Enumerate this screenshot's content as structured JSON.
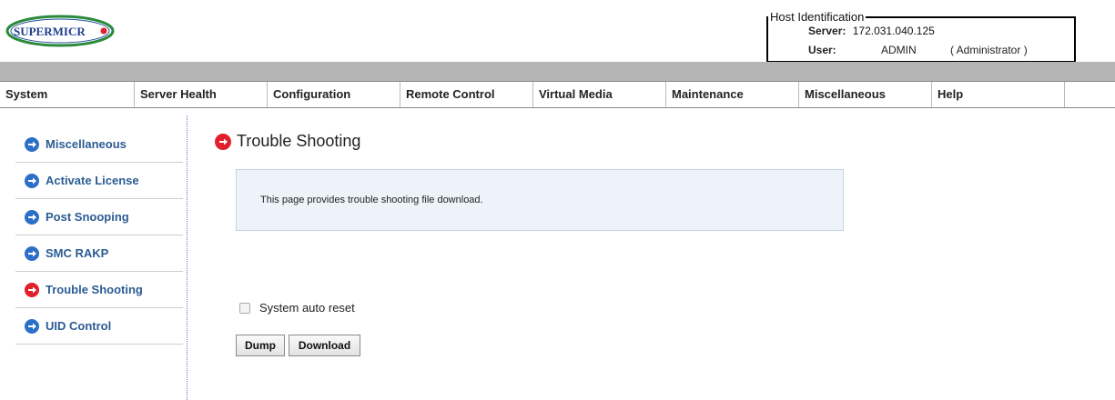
{
  "brand": {
    "logo_text": "SUPERMICR"
  },
  "host": {
    "title": "Host Identification",
    "server_label": "Server:",
    "server_value": "172.031.040.125",
    "user_label": "User:",
    "user_value": "ADMIN",
    "role": "( Administrator )"
  },
  "nav": {
    "items": [
      {
        "label": "System"
      },
      {
        "label": "Server Health"
      },
      {
        "label": "Configuration"
      },
      {
        "label": "Remote Control"
      },
      {
        "label": "Virtual Media"
      },
      {
        "label": "Maintenance"
      },
      {
        "label": "Miscellaneous"
      },
      {
        "label": "Help"
      }
    ]
  },
  "sidebar": {
    "items": [
      {
        "label": "Miscellaneous",
        "icon": "arrow-right-circle-icon",
        "active": false
      },
      {
        "label": "Activate License",
        "icon": "arrow-right-circle-icon",
        "active": false
      },
      {
        "label": "Post Snooping",
        "icon": "arrow-right-circle-icon",
        "active": false
      },
      {
        "label": "SMC RAKP",
        "icon": "arrow-right-circle-icon",
        "active": false
      },
      {
        "label": "Trouble Shooting",
        "icon": "arrow-right-circle-icon",
        "active": true
      },
      {
        "label": "UID Control",
        "icon": "arrow-right-circle-icon",
        "active": false
      }
    ]
  },
  "main": {
    "title": "Trouble Shooting",
    "info": "This page provides trouble shooting file download.",
    "auto_reset_label": "System auto reset",
    "auto_reset_checked": false,
    "dump_label": "Dump",
    "download_label": "Download"
  },
  "colors": {
    "nav_band": "#b4b4b4",
    "link_blue": "#2b5c93",
    "arrow_blue": "#2c6fc7",
    "arrow_red": "#e0202a",
    "info_bg": "#eef3fa"
  }
}
